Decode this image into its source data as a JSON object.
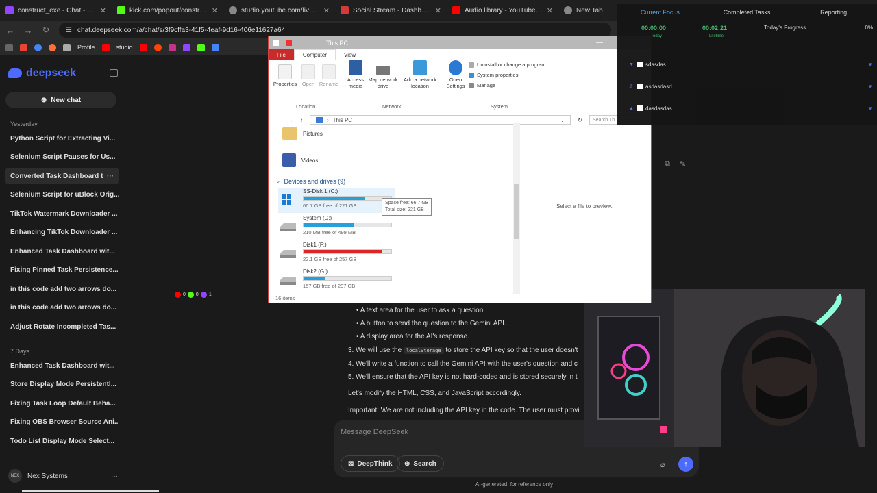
{
  "browser": {
    "tabs": [
      {
        "title": "construct_exe - Chat - Twitch",
        "color": "#9146ff"
      },
      {
        "title": "kick.com/popout/construct-exe",
        "color": "#53fc18"
      },
      {
        "title": "studio.youtube.com/live_chat",
        "color": "#888888"
      },
      {
        "title": "Social Stream - Dashboard",
        "color": "#d33a3a"
      },
      {
        "title": "Audio library - YouTube Studio",
        "color": "#ff0000"
      },
      {
        "title": "New Tab",
        "color": "#888888"
      }
    ],
    "url": "chat.deepseek.com/a/chat/s/3f9cffa3-41f5-4eaf-9d16-406e11627a64",
    "bookmarks": [
      "Profile",
      "studio"
    ]
  },
  "sidebar": {
    "logo": "deepseek",
    "new_chat": "New chat",
    "sections": [
      {
        "label": "Yesterday",
        "items": [
          "Python Script for Extracting Vi...",
          "Selenium Script Pauses for Us...",
          "Converted Task Dashboard t",
          "Selenium Script for uBlock Orig...",
          "TikTok Watermark Downloader ...",
          "Enhancing TikTok Downloader ...",
          "Enhanced Task Dashboard wit...",
          "Fixing Pinned Task Persistence...",
          "in this code add two arrows do...",
          "in this code add two arrows do...",
          "Adjust Rotate Incompleted Tas..."
        ]
      },
      {
        "label": "7 Days",
        "items": [
          "Enhanced Task Dashboard wit...",
          "Store Display Mode Persistentl...",
          "Fixing Task Loop Default Beha...",
          "Fixing OBS Browser Source Ani...",
          "Todo List Display Mode Select..."
        ]
      }
    ],
    "user": "Nex Systems",
    "avatar_text": "NEX"
  },
  "stream_counts": [
    "0",
    "0",
    "1"
  ],
  "chat": {
    "lines": [
      "A text area for the user to ask a question.",
      "A button to send the question to the Gemini API.",
      "A display area for the AI's response.",
      "3. We will use the",
      "localStorage",
      "to store the API key so that the user doesn't",
      "4. We'll write a function to call the Gemini API with the user's question and c",
      "5. We'll ensure that the API key is not hard-coded and is stored securely in t",
      "Let's modify the HTML, CSS, and JavaScript accordingly.",
      "Important: We are not including the API key in the code. The user must provi"
    ],
    "placeholder": "Message DeepSeek",
    "deepthink": "DeepThink",
    "search": "Search",
    "footnote": "AI-generated, for reference only"
  },
  "explorer": {
    "title": "This PC",
    "tabs": [
      "File",
      "Computer",
      "View"
    ],
    "ribbon": {
      "location": [
        "Properties",
        "Open",
        "Rename"
      ],
      "network": [
        "Access media",
        "Map network drive",
        "Add a network location"
      ],
      "system_btn": "Open Settings",
      "system_items": [
        "Uninstall or change a program",
        "System properties",
        "Manage"
      ],
      "groups": [
        "Location",
        "Network",
        "System"
      ]
    },
    "breadcrumb": "This PC",
    "search_placeholder": "Search Th...",
    "folders": [
      "Pictures",
      "Videos"
    ],
    "drives_header": "Devices and drives (9)",
    "drives": [
      {
        "name": "SS-Disk 1 (C:)",
        "free": "66.7 GB free of 221 GB",
        "used_fraction": 0.7,
        "color": "#26a0da"
      },
      {
        "name": "System (D:)",
        "free": "210 MB free of 499 MB",
        "used_fraction": 0.58,
        "color": "#26a0da"
      },
      {
        "name": "Disk1 (F:)",
        "free": "22.1 GB free of 257 GB",
        "used_fraction": 0.9,
        "color": "#da2626"
      },
      {
        "name": "Disk2 (G:)",
        "free": "157 GB free of 207 GB",
        "used_fraction": 0.24,
        "color": "#26a0da"
      }
    ],
    "tooltip": [
      "Space free: 66.7 GB",
      "Total size: 221 GB"
    ],
    "preview": "Select a file to preview.",
    "count": "16 items"
  },
  "dashboard": {
    "tabs": [
      "Current Focus",
      "Completed Tasks",
      "Reporting"
    ],
    "focus_time": "00:00:00",
    "focus_label": "Today",
    "lifetime_time": "00:02:21",
    "lifetime_label": "Lifetime",
    "progress_label": "Today's Progress",
    "progress_pct": "0%",
    "tasks": [
      "sdasdas",
      "asdasdasd",
      "dasdasdas"
    ]
  }
}
